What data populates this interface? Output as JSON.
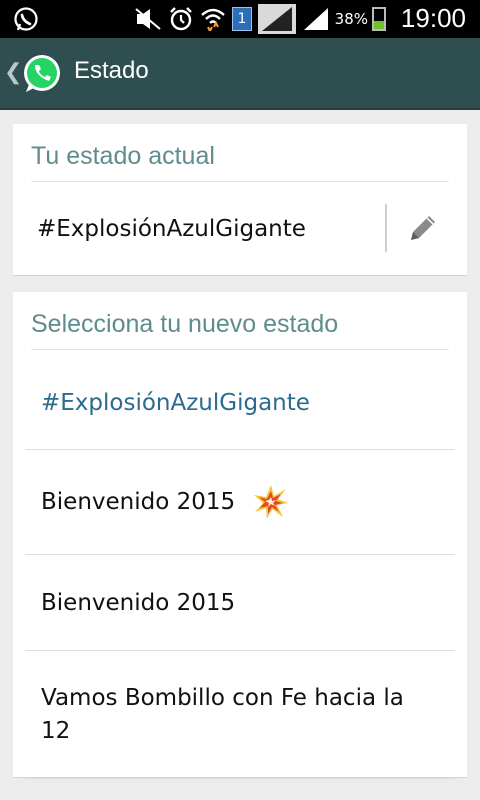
{
  "statusbar": {
    "sim_badge": "1",
    "battery_pct": "38%",
    "battery_level": 0.38,
    "time": "19:00"
  },
  "actionbar": {
    "title": "Estado"
  },
  "current": {
    "header": "Tu estado actual",
    "status_text": "#ExplosiónAzulGigante"
  },
  "choose": {
    "header": "Selecciona tu nuevo estado",
    "items": [
      {
        "label": "#ExplosiónAzulGigante",
        "selected": true
      },
      {
        "label": "Bienvenido 2015",
        "emoji": "collision-icon"
      },
      {
        "label": "Bienvenido 2015"
      },
      {
        "label": "Vamos Bombillo con Fe hacia la 12"
      }
    ]
  },
  "colors": {
    "actionbar": "#2f4e4f",
    "accent_text": "#5f8c8c",
    "selected_text": "#2c6a8e",
    "whatsapp_green": "#25d366"
  }
}
